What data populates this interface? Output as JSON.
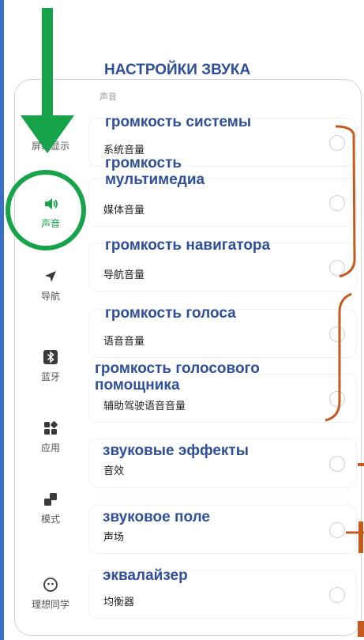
{
  "heading": "НАСТРОЙКИ ЗВУКА",
  "section_label": "声音",
  "sidebar": {
    "items": [
      {
        "label": "屏幕显示",
        "icon": "display-icon"
      },
      {
        "label": "声音",
        "icon": "speaker-icon",
        "active": true
      },
      {
        "label": "导航",
        "icon": "navigation-arrow-icon"
      },
      {
        "label": "蓝牙",
        "icon": "bluetooth-icon"
      },
      {
        "label": "应用",
        "icon": "apps-icon"
      },
      {
        "label": "模式",
        "icon": "mode-icon"
      },
      {
        "label": "理想同学",
        "icon": "assistant-face-icon"
      }
    ]
  },
  "settings": [
    {
      "label": "系统音量",
      "annotation": "громкость системы"
    },
    {
      "label": "媒体音量",
      "annotation": "громкость мультимедиа"
    },
    {
      "label": "导航音量",
      "annotation": "громкость навигатора"
    },
    {
      "label": "语音音量",
      "annotation": "громкость голоса"
    },
    {
      "label": "辅助驾驶语音音量",
      "annotation": "громкость голосового помощника"
    },
    {
      "label": "音效",
      "annotation": "звуковые эффекты"
    },
    {
      "label": "声场",
      "annotation": "звуковое поле"
    },
    {
      "label": "均衡器",
      "annotation": "эквалайзер"
    }
  ],
  "colors": {
    "annotation_text": "#2f4f9a",
    "arrow": "#16a34a",
    "bracket": "#c65a1e",
    "accent_blue": "#3a6fc9"
  }
}
